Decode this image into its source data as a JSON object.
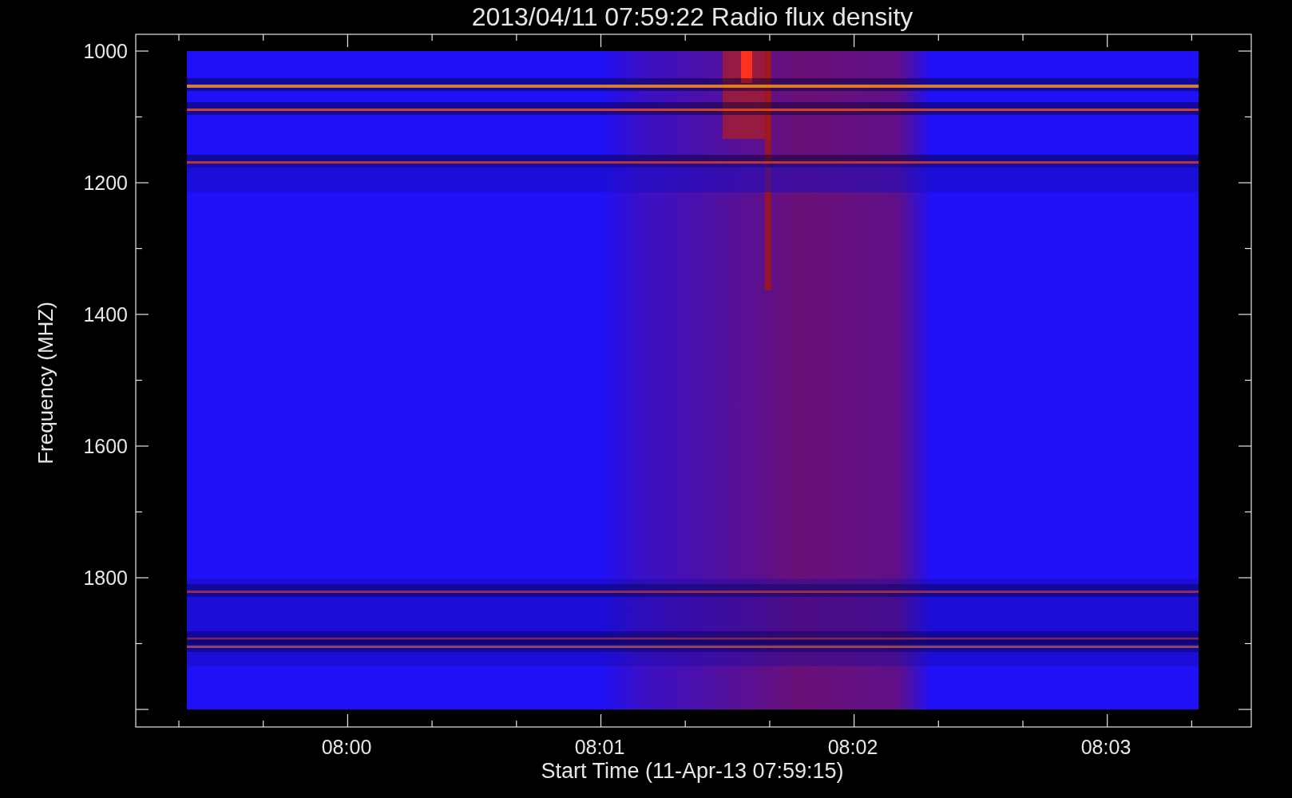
{
  "title": "2013/04/11 07:59:22 Radio flux density",
  "y_axis": {
    "label": "Frequency (MHZ)",
    "ticks": [
      "1000",
      "1200",
      "1400",
      "1600",
      "1800"
    ]
  },
  "x_axis": {
    "label": "Start Time (11-Apr-13 07:59:15)",
    "ticks": [
      "08:00",
      "08:01",
      "08:02",
      "08:03"
    ]
  }
}
